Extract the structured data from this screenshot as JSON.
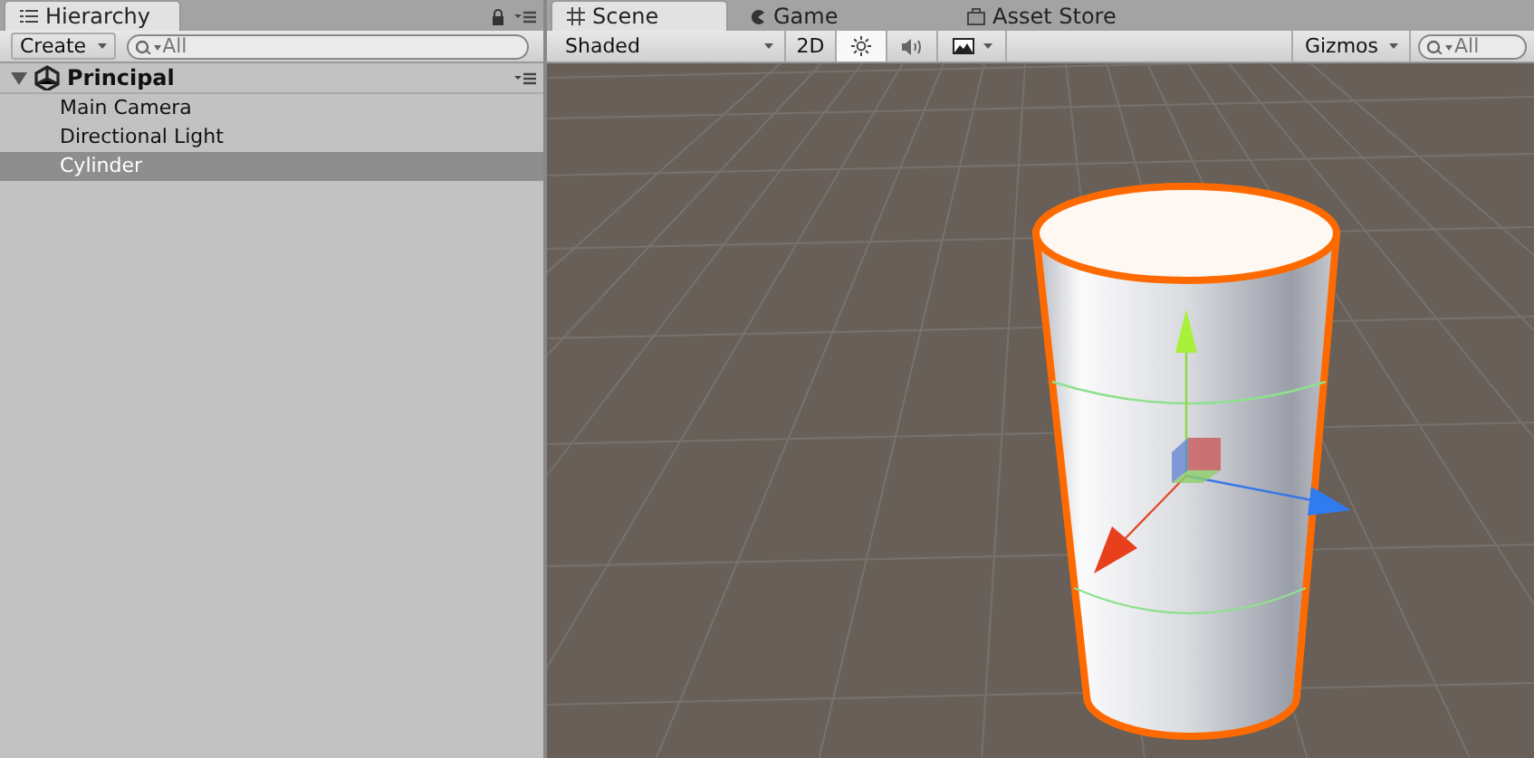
{
  "hierarchy": {
    "tab": {
      "label": "Hierarchy",
      "selected": true
    },
    "create_button": "Create",
    "search": {
      "placeholder": "All"
    },
    "scene": {
      "name": "Principal",
      "expanded": true,
      "children": [
        {
          "name": "Main Camera",
          "selected": false
        },
        {
          "name": "Directional Light",
          "selected": false
        },
        {
          "name": "Cylinder",
          "selected": true
        }
      ]
    }
  },
  "scene_view": {
    "tabs": [
      {
        "label": "Scene",
        "kind": "scene",
        "selected": true
      },
      {
        "label": "Game",
        "kind": "game",
        "selected": false
      },
      {
        "label": "Asset Store",
        "kind": "store",
        "selected": false
      }
    ],
    "toolbar": {
      "draw_mode": "Shaded",
      "mode_2d": {
        "label": "2D",
        "on": false
      },
      "lighting": {
        "on": true
      },
      "audio": {
        "on": false
      },
      "gizmos": "Gizmos",
      "search": {
        "placeholder": "All"
      }
    }
  }
}
